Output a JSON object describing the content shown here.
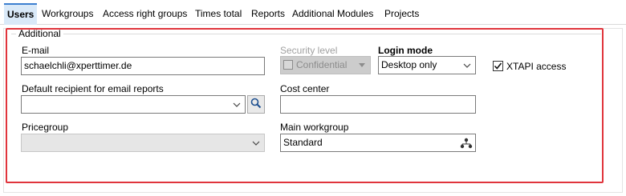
{
  "tabs": [
    {
      "label": "Users",
      "active": true
    },
    {
      "label": "Workgroups"
    },
    {
      "label": "Access right groups"
    },
    {
      "label": "Times total"
    },
    {
      "label": "Reports"
    },
    {
      "label": "Additional Modules"
    },
    {
      "label": "Projects"
    }
  ],
  "section": {
    "title": "Additional"
  },
  "email": {
    "label": "E-mail",
    "value": "schaelchli@xperttimer.de"
  },
  "security_level": {
    "label": "Security level",
    "value": "Confidential"
  },
  "login_mode": {
    "label": "Login mode",
    "value": "Desktop only"
  },
  "xtapi": {
    "label": "XTAPI access",
    "checked": true
  },
  "default_recipient": {
    "label": "Default recipient for email reports",
    "value": ""
  },
  "cost_center": {
    "label": "Cost center",
    "value": ""
  },
  "pricegroup": {
    "label": "Pricegroup",
    "value": ""
  },
  "main_workgroup": {
    "label": "Main workgroup",
    "value": "Standard"
  },
  "colors": {
    "highlight": "#e0343c",
    "active_tab": "#d9e9f8"
  }
}
